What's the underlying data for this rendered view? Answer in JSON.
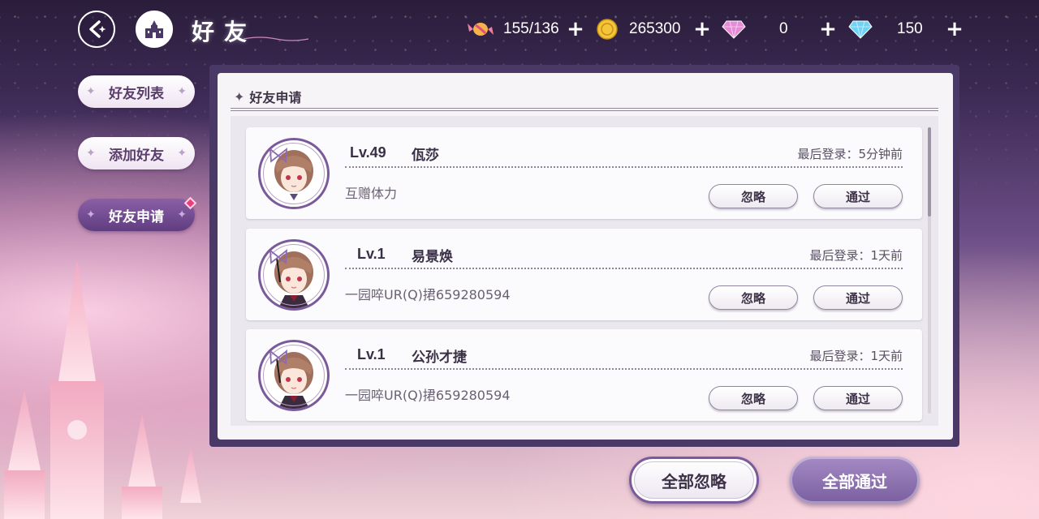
{
  "header": {
    "title": "好友",
    "resources": [
      {
        "icon": "candy-icon",
        "value": "155/136"
      },
      {
        "icon": "gold-coin-icon",
        "value": "265300"
      },
      {
        "icon": "pink-gem-icon",
        "value": "0"
      },
      {
        "icon": "blue-diamond-icon",
        "value": "150"
      }
    ]
  },
  "sidebar": {
    "tabs": [
      {
        "label": "好友列表"
      },
      {
        "label": "添加好友"
      },
      {
        "label": "好友申请"
      }
    ]
  },
  "section": {
    "title": "好友申请"
  },
  "requests": [
    {
      "level": "Lv.49",
      "name": "佤莎",
      "last_login": "最后登录：5分钟前",
      "message": "互赠体力"
    },
    {
      "level": "Lv.1",
      "name": "易景焕",
      "last_login": "最后登录：1天前",
      "message": "一园啐UR(Q)捃659280594"
    },
    {
      "level": "Lv.1",
      "name": "公孙才捷",
      "last_login": "最后登录：1天前",
      "message": "一园啐UR(Q)捃659280594"
    }
  ],
  "buttons": {
    "ignore": "忽略",
    "accept": "通过",
    "ignore_all": "全部忽略",
    "accept_all": "全部通过"
  },
  "colors": {
    "accent": "#7a5ea0",
    "panel_border": "#4a3966",
    "badge": "#e8407a"
  }
}
